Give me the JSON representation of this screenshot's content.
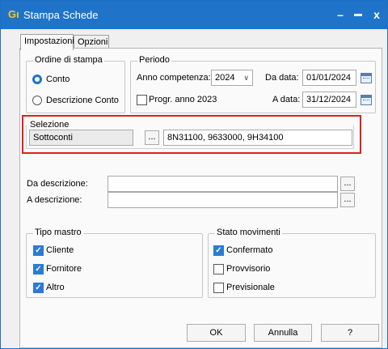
{
  "window": {
    "title": "Stampa Schede",
    "app_icon": "Gı",
    "minimize_glyph": "–",
    "maximize_glyph": "▬",
    "close_glyph": "x"
  },
  "tabs": [
    {
      "label": "Impostazioni",
      "active": true
    },
    {
      "label": "Opzioni",
      "active": false
    }
  ],
  "ordine": {
    "legend": "Ordine di stampa",
    "options": [
      {
        "label": "Conto",
        "selected": true
      },
      {
        "label": "Descrizione Conto",
        "selected": false
      }
    ]
  },
  "periodo": {
    "legend": "Periodo",
    "anno_label": "Anno competenza:",
    "anno_value": "2024",
    "progr_label": "Progr. anno 2023",
    "progr_checked": false,
    "da_data_label": "Da data:",
    "da_data_value": "01/01/2024",
    "a_data_label": "A data:",
    "a_data_value": "31/12/2024"
  },
  "selezione": {
    "legend": "Selezione",
    "type_value": "Sottoconti",
    "browse_label": "...",
    "codes_value": "8N31100, 9633000, 9H34100"
  },
  "descrizione": {
    "da_label": "Da descrizione:",
    "da_value": "",
    "a_label": "A descrizione:",
    "a_value": "",
    "browse_label": "..."
  },
  "tipo_mastro": {
    "legend": "Tipo mastro",
    "items": [
      {
        "label": "Cliente",
        "checked": true
      },
      {
        "label": "Fornitore",
        "checked": true
      },
      {
        "label": "Altro",
        "checked": true
      }
    ]
  },
  "stato_movimenti": {
    "legend": "Stato movimenti",
    "items": [
      {
        "label": "Confermato",
        "checked": true
      },
      {
        "label": "Provvisorio",
        "checked": false
      },
      {
        "label": "Previsionale",
        "checked": false
      }
    ]
  },
  "buttons": {
    "ok": "OK",
    "annulla": "Annulla",
    "help": "?"
  },
  "colors": {
    "titlebar": "#1f74c9",
    "highlight_box": "#e02020",
    "check_on": "#2b7bd4"
  }
}
